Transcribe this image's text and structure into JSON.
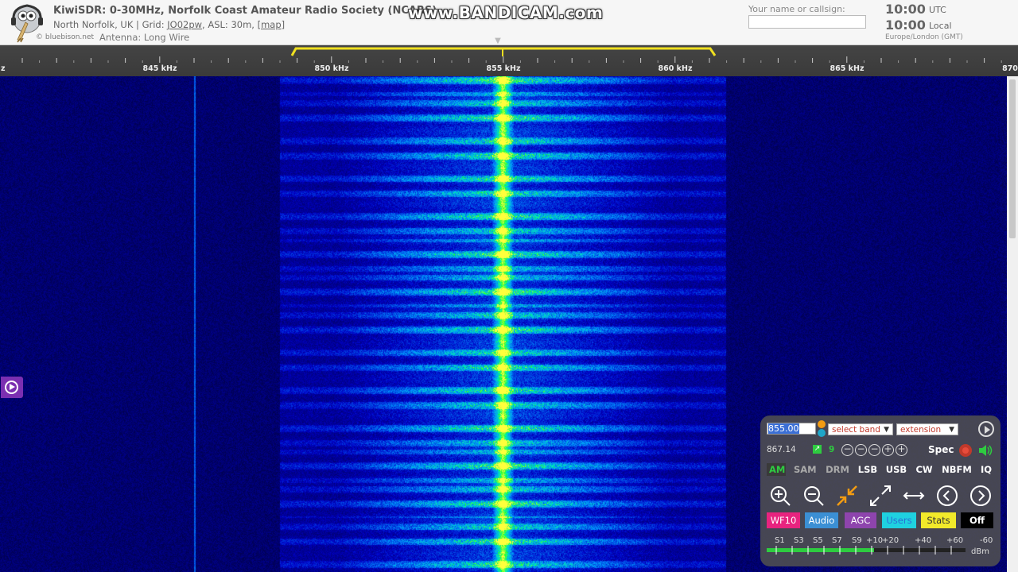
{
  "header": {
    "title": "KiwiSDR: 0-30MHz, Norfolk Coast Amateur Radio Society (NCARS)",
    "location": "North Norfolk, UK | Grid: ",
    "grid": "JO02pw",
    "asl": ", ASL: 30m, ",
    "map_link": "[map]",
    "credit": "© bluebison.net",
    "antenna": "Antenna: Long Wire",
    "watermark": "www.BANDICAM.com",
    "name_label": "Your name or callsign:",
    "name_placeholder": "",
    "utc_time": "10:00",
    "utc_label": "UTC",
    "local_time": "10:00",
    "local_label": "Local",
    "timezone": "Europe/London (GMT)"
  },
  "scale": {
    "labels": [
      "845 kHz",
      "850 kHz",
      "855 kHz",
      "860 kHz",
      "865 kHz",
      "870"
    ],
    "edge_char": "z"
  },
  "panel": {
    "frequency": "855.00",
    "band_select": "select band",
    "extension_select": "extension",
    "cutoff": "867.14",
    "zoom_level": "9",
    "spec_label": "Spec",
    "modes": [
      "AM",
      "SAM",
      "DRM",
      "LSB",
      "USB",
      "CW",
      "NBFM",
      "IQ"
    ],
    "active_mode": "AM",
    "tabs": [
      "WF10",
      "Audio",
      "AGC",
      "Users",
      "Stats",
      "Off"
    ],
    "smeter_labels": [
      "S1",
      "S3",
      "S5",
      "S7",
      "S9",
      "+10",
      "+20",
      "+40",
      "+60"
    ],
    "dbm_value": "-60",
    "dbm_unit": "dBm",
    "smeter_level_fraction": 0.54
  },
  "colors": {
    "passband": "#f0e020",
    "mode_active": "#2ecc40",
    "tab_wf": "#e8237f",
    "tab_audio": "#3b8fd4",
    "tab_agc": "#8e44ad",
    "tab_users": "#1fd1e0",
    "tab_stats": "#f2ea2a",
    "tab_off": "#000000"
  },
  "icons": {
    "side_button": "play-circle-icon",
    "panel_play": "play-circle-icon",
    "mute": "speaker-icon",
    "record": "record-icon"
  }
}
